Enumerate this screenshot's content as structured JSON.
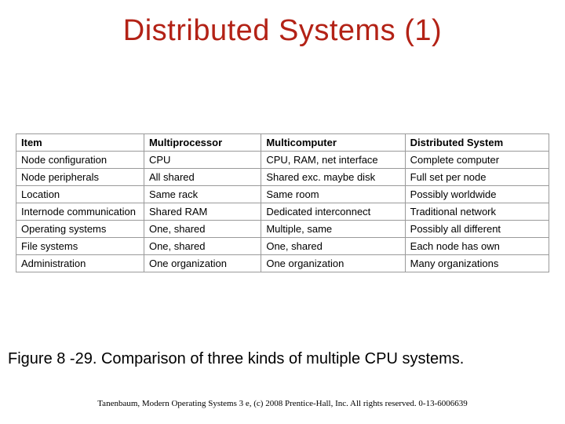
{
  "title": {
    "text": "Distributed Systems (1)",
    "color": "#B32216"
  },
  "table": {
    "headers": [
      "Item",
      "Multiprocessor",
      "Multicomputer",
      "Distributed System"
    ],
    "rows": [
      [
        "Node configuration",
        "CPU",
        "CPU, RAM, net interface",
        "Complete computer"
      ],
      [
        "Node peripherals",
        "All shared",
        "Shared exc. maybe disk",
        "Full set per node"
      ],
      [
        "Location",
        "Same rack",
        "Same room",
        "Possibly worldwide"
      ],
      [
        "Internode communication",
        "Shared RAM",
        "Dedicated interconnect",
        "Traditional network"
      ],
      [
        "Operating systems",
        "One, shared",
        "Multiple, same",
        "Possibly all different"
      ],
      [
        "File systems",
        "One, shared",
        "One, shared",
        "Each node has own"
      ],
      [
        "Administration",
        "One organization",
        "One organization",
        "Many organizations"
      ]
    ]
  },
  "caption": "Figure 8 -29. Comparison of three kinds of multiple CPU systems.",
  "footer": "Tanenbaum, Modern Operating Systems 3 e, (c) 2008 Prentice-Hall, Inc. All rights reserved. 0-13-6006639"
}
